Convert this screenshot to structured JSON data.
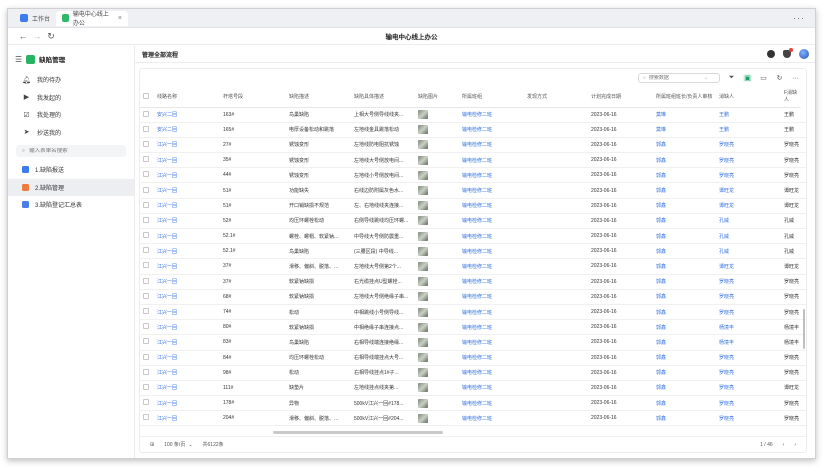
{
  "browser": {
    "tabs": [
      {
        "label": "工作台",
        "icon": "grid-icon"
      },
      {
        "label": "输电中心线上办公",
        "icon": "app-icon"
      }
    ],
    "address_title": "输电中心线上办公"
  },
  "sidebar": {
    "app_name": "缺陷管理",
    "nav": [
      {
        "label": "我的待办",
        "icon": "bell-icon"
      },
      {
        "label": "我发起的",
        "icon": "send-icon"
      },
      {
        "label": "我处理的",
        "icon": "check-icon"
      },
      {
        "label": "抄送我的",
        "icon": "paper-plane-icon"
      }
    ],
    "search_placeholder": "输入表单名搜索",
    "forms": [
      {
        "label": "1.缺陷报送",
        "color": "#3d7bf0"
      },
      {
        "label": "2.缺陷管理",
        "color": "#f07a3d"
      },
      {
        "label": "3.缺陷登记汇总表",
        "color": "#4c7de8"
      }
    ]
  },
  "main": {
    "title": "管理全部流程",
    "search_placeholder": "搜索数据"
  },
  "table": {
    "headers": [
      "线路名称",
      "杆塔号段",
      "缺陷描述",
      "缺陷具体描述",
      "缺陷图片",
      "所属班组",
      "发现方式",
      "计划完成日期",
      "所属班组班长/负责人审核",
      "消缺人",
      "F消缺人"
    ],
    "rows": [
      [
        "安兴二回",
        "163#",
        "鸟巢缺陷",
        "上相大号侧导线线夹...",
        "输电检修二班",
        "",
        "2023-06-16",
        "莫琳",
        "王鹏",
        "王鹏"
      ],
      [
        "安兴二回",
        "165#",
        "电厚设备松动和跳落",
        "左地线金具跳落松动",
        "输电检修二班",
        "",
        "2023-06-16",
        "莫琳",
        "王鹏",
        "王鹏"
      ],
      [
        "江兴一回",
        "27#",
        "锈蚀变形",
        "左地线防电阻抗锈蚀",
        "输电检修二班",
        "",
        "2023-06-16",
        "郭鑫",
        "罗晓亮",
        "罗晓亮"
      ],
      [
        "江兴一回",
        "35#",
        "锈蚀变形",
        "左地线大号侧放电间...",
        "输电检修二班",
        "",
        "2023-06-16",
        "郭鑫",
        "罗晓亮",
        "罗晓亮"
      ],
      [
        "江兴一回",
        "44#",
        "锈蚀变形",
        "左地线小号侧放电间...",
        "输电检修二班",
        "",
        "2023-06-16",
        "郭鑫",
        "罗晓亮",
        "罗晓亮"
      ],
      [
        "江兴一回",
        "51#",
        "功能缺失",
        "右线边防附属灰色水...",
        "输电检修二班",
        "",
        "2023-06-16",
        "郭鑫",
        "谭旺龙",
        "谭旺龙"
      ],
      [
        "江兴一回",
        "51#",
        "开口销缺损不规范",
        "左、右地线线夹连接...",
        "输电检修二班",
        "",
        "2023-06-16",
        "郭鑫",
        "谭旺龙",
        "谭旺龙"
      ],
      [
        "江兴一回",
        "52#",
        "均压环螺栓松动",
        "右侧导线跳线均压环螺...",
        "输电检修二班",
        "",
        "2023-06-16",
        "郭鑫",
        "孔威",
        "孔威"
      ],
      [
        "江兴一回",
        "52.1#",
        "螺栓、螺帽、软紧钠...",
        "中导线大号侧防震重...",
        "输电检修二班",
        "",
        "2023-06-16",
        "郭鑫",
        "孔威",
        "孔威"
      ],
      [
        "江兴一回",
        "52.1#",
        "鸟巢缺陷",
        "(三腰区段) 中导线...",
        "输电检修二班",
        "",
        "2023-06-16",
        "郭鑫",
        "孔威",
        "孔威"
      ],
      [
        "江兴一回",
        "37#",
        "滑移、偏斜、脱落、...",
        "左地线大号侧第2个...",
        "输电检修二班",
        "",
        "2023-06-16",
        "郭鑫",
        "谭旺龙",
        "谭旺龙"
      ],
      [
        "江兴一回",
        "37#",
        "软紧钠缺损",
        "右光缆挂点U型螺栓...",
        "输电检修二班",
        "",
        "2023-06-16",
        "郭鑫",
        "罗晓亮",
        "罗晓亮"
      ],
      [
        "江兴一回",
        "68#",
        "软紧钠缺损",
        "左地线大号侧绝缘子串...",
        "输电检修二班",
        "",
        "2023-06-16",
        "郭鑫",
        "罗晓亮",
        "罗晓亮"
      ],
      [
        "江兴一回",
        "74#",
        "松动",
        "中相跳线小号侧导线...",
        "输电检修二班",
        "",
        "2023-06-16",
        "郭鑫",
        "罗晓亮",
        "罗晓亮"
      ],
      [
        "江兴一回",
        "80#",
        "软紧钠缺损",
        "中相绝缘子串连接点...",
        "输电检修二班",
        "",
        "2023-06-16",
        "郭鑫",
        "杨境丰",
        "杨境丰"
      ],
      [
        "江兴一回",
        "83#",
        "鸟巢缺陷",
        "右相导线端连接绝缘...",
        "输电检修二班",
        "",
        "2023-06-16",
        "郭鑫",
        "杨境丰",
        "杨境丰"
      ],
      [
        "江兴一回",
        "84#",
        "均压环螺栓松动",
        "右相导线端挂点大号...",
        "输电检修二班",
        "",
        "2023-06-16",
        "郭鑫",
        "罗晓亮",
        "罗晓亮"
      ],
      [
        "江兴一回",
        "98#",
        "松动",
        "右相导线挂点1#子...",
        "输电检修二班",
        "",
        "2023-06-16",
        "郭鑫",
        "罗晓亮",
        "罗晓亮"
      ],
      [
        "江兴一回",
        "111#",
        "缺垫片",
        "左地线挂点线夹第...",
        "输电检修二班",
        "",
        "2023-06-16",
        "郭鑫",
        "罗晓亮",
        "谭旺龙"
      ],
      [
        "江兴一回",
        "178#",
        "异物",
        "500kV江兴一回#178...",
        "输电检修二班",
        "",
        "2023-06-16",
        "郭鑫",
        "罗晓亮",
        "罗晓亮"
      ],
      [
        "江兴一回",
        "204#",
        "滑移、偏斜、脱落、...",
        "500kV江兴一回#204...",
        "输电检修二班",
        "",
        "2023-06-16",
        "郭鑫",
        "罗晓亮",
        "罗晓亮"
      ]
    ]
  },
  "footer": {
    "page_size": "100 条/页",
    "total": "共6122条",
    "page_info": "1 / 46"
  }
}
